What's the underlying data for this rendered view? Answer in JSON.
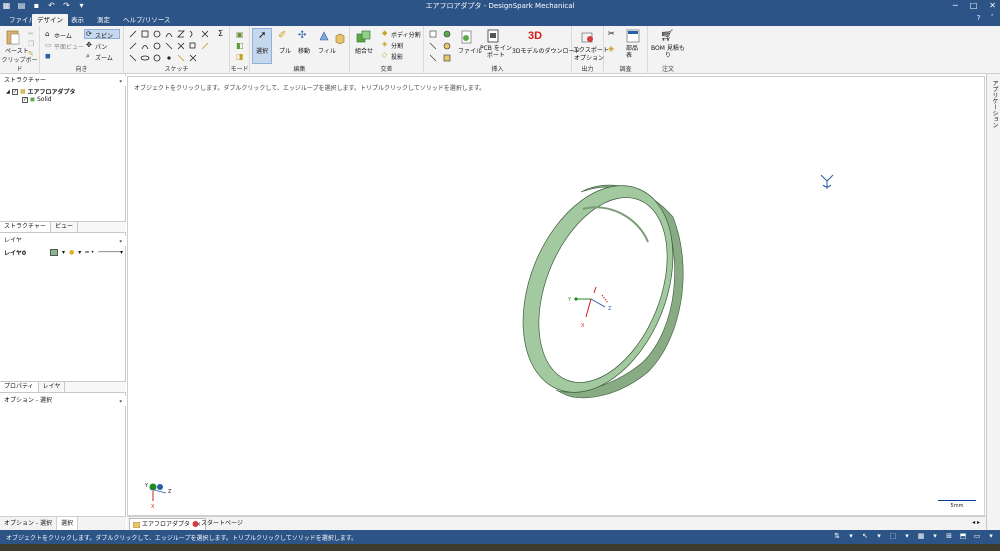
{
  "titlebar": {
    "title": "エアフロアダプタ - DesignSpark Mechanical",
    "window_buttons": [
      "─",
      "□",
      "✕"
    ]
  },
  "ribbon_tabs": [
    {
      "label": "ファイル",
      "active": false
    },
    {
      "label": "デザイン",
      "active": true
    },
    {
      "label": "表示",
      "active": false
    },
    {
      "label": "測定",
      "active": false
    },
    {
      "label": "ヘルプ/リソース",
      "active": false
    }
  ],
  "ribbon": {
    "clipboard": {
      "paste": "ペースト",
      "label": "クリップボード"
    },
    "orient": {
      "home": "ホーム",
      "plan_view": "平面ビュー",
      "spin": "スピン",
      "pan": "パン",
      "zoom": "ズーム",
      "label": "向き"
    },
    "sketch": {
      "label": "スケッチ",
      "sigma": "Σ"
    },
    "mode": {
      "label": "モード"
    },
    "edit": {
      "select": "選択",
      "pull": "プル",
      "move": "移動",
      "fill": "フィル",
      "label": "編集"
    },
    "intersect": {
      "combine": "組合せ",
      "split_body": "ボディ分割",
      "split": "分割",
      "project": "投影",
      "label": "交差"
    },
    "insert": {
      "file": "ファイル",
      "pcb_import": "PCB をイン\nポート",
      "download_3d_badge": "3D",
      "download_3d": "3Dモデルのダウンロード",
      "label": "挿入"
    },
    "output": {
      "export": "エクスポート",
      "options": "オプション",
      "label": "出力"
    },
    "investigate": {
      "parts_table": "部品\n表",
      "label": "調査"
    },
    "order": {
      "bom": "BOM 見積も\nり",
      "label": "注文"
    }
  },
  "left_panel": {
    "structure_header": "ストラクチャー",
    "tree_root": "エアフロアダプタ",
    "tree_child": "Solid",
    "tabs_top": [
      {
        "label": "ストラクチャー",
        "active": true
      },
      {
        "label": "ビュー",
        "active": false
      }
    ],
    "layer_header": "レイヤ",
    "layer_name": "レイヤ0",
    "tabs_bottom": [
      {
        "label": "プロパティ",
        "active": true
      },
      {
        "label": "レイヤ",
        "active": false
      }
    ],
    "options_header": "オプション - 選択",
    "bottom_tabs": [
      {
        "label": "オプション - 選択",
        "active": false
      },
      {
        "label": "選択",
        "active": true
      }
    ]
  },
  "right_strip": {
    "label": "アプリケーション"
  },
  "viewport": {
    "hint": "オブジェクトをクリックします。ダブルクリックして、エッジループを選択します。トリプルクリックしてソリッドを選択します。",
    "scale": "5mm",
    "axis_labels": {
      "x": "X",
      "y": "Y",
      "z": "Z"
    },
    "ring_color": "#a3c9a0"
  },
  "doc_tabs": [
    {
      "label": "エアフロアダプタ",
      "active": true,
      "close": "×"
    },
    {
      "label": "スタートページ",
      "active": false
    }
  ],
  "doc_nav": "◂ ▸",
  "statusbar": {
    "message": "オブジェクトをクリックします。ダブルクリックして、エッジループを選択します。トリプルクリックしてソリッドを選択します。"
  }
}
